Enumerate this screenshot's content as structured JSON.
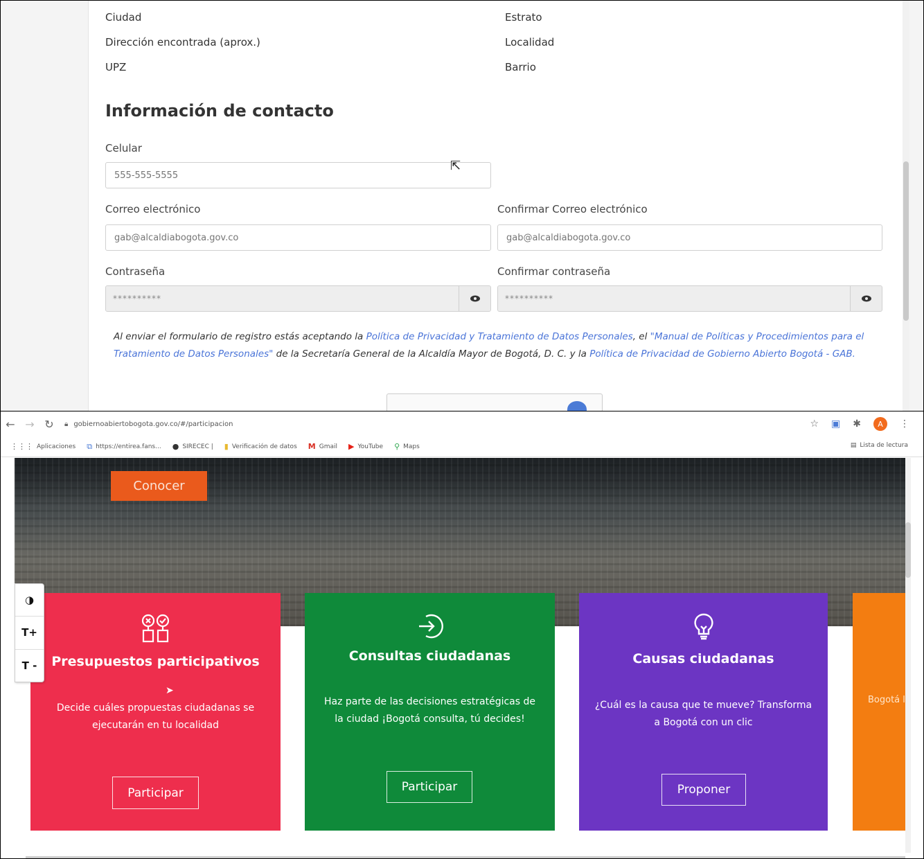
{
  "registration_form": {
    "address_labels": {
      "city": "Ciudad",
      "stratum": "Estrato",
      "found_address": "Dirección encontrada (aprox.)",
      "locality": "Localidad",
      "upz": "UPZ",
      "neighborhood": "Barrio"
    },
    "contact_section_title": "Información de contacto",
    "phone": {
      "label": "Celular",
      "placeholder": "555-555-5555"
    },
    "email": {
      "label": "Correo electrónico",
      "placeholder": "gab@alcaldiabogota.gov.co"
    },
    "email_confirm": {
      "label": "Confirmar Correo electrónico",
      "placeholder": "gab@alcaldiabogota.gov.co"
    },
    "password": {
      "label": "Contraseña",
      "value": "**********"
    },
    "password_confirm": {
      "label": "Confirmar contraseña",
      "value": "**********"
    },
    "legal": {
      "text_1": "Al enviar el formulario de registro estás aceptando la ",
      "link_1": "Política de Privacidad y Tratamiento de Datos Personales",
      "text_2": ", el ",
      "link_2": "\"Manual de Políticas y Procedimientos para el Tratamiento de Datos Personales\"",
      "text_3": " de la Secretaría General de la Alcaldía Mayor de Bogotá, D. C. y la ",
      "link_3": "Política de Privacidad de Gobierno Abierto Bogotá - GAB."
    }
  },
  "browser": {
    "url": "gobiernoabiertobogota.gov.co/#/participacion",
    "bookmarks": [
      {
        "label": "Aplicaciones",
        "icon": "apps-grid-icon"
      },
      {
        "label": "https://entirea.fans...",
        "icon": "link-icon"
      },
      {
        "label": "SIRECEC |",
        "icon": "circle-icon"
      },
      {
        "label": "Verificación de datos",
        "icon": "folder-icon"
      },
      {
        "label": "Gmail",
        "icon": "gmail-icon"
      },
      {
        "label": "YouTube",
        "icon": "youtube-icon"
      },
      {
        "label": "Maps",
        "icon": "maps-pin-icon"
      }
    ],
    "reading_list": "Lista de lectura",
    "profile_initial": "A"
  },
  "hero": {
    "button": "Conocer"
  },
  "accessibility": {
    "contrast": "◑",
    "increase_text": "T+",
    "decrease_text": "T -"
  },
  "cards": {
    "presupuestos": {
      "title": "Presupuestos participativos",
      "description": "Decide cuáles propuestas ciudadanas se ejecutarán en tu localidad",
      "button": "Participar",
      "color": "#ee2e4d"
    },
    "consultas": {
      "title": "Consultas ciudadanas",
      "description": "Haz parte de las decisiones estratégicas de la ciudad ¡Bogotá consulta, tú decides!",
      "button": "Participar",
      "color": "#0f8a3a"
    },
    "causas": {
      "title": "Causas ciudadanas",
      "description": "¿Cuál es la causa que te mueve? Transforma a Bogotá con un clic",
      "button": "Proponer",
      "color": "#6c35c3"
    },
    "fourth": {
      "description": "Bogotá llevar a y con",
      "color": "#f37d11"
    }
  }
}
